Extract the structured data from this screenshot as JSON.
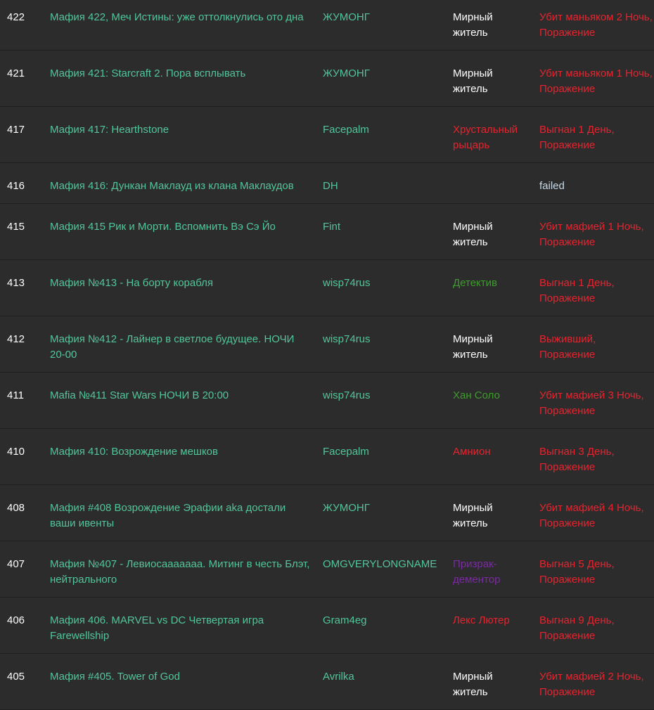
{
  "colors": {
    "background": "#2c2c2c",
    "link": "#52c59b",
    "civilian": "#ffffff",
    "red": "#e8232e",
    "green": "#3f9b2e",
    "purple": "#7b2aa3",
    "failed": "#c8dce8"
  },
  "games": [
    {
      "number": "422",
      "title": "Мафия 422, Меч Истины: уже оттолкнулись ото дна",
      "host": "ЖУМОНГ",
      "role": "Мирный житель",
      "role_color": "white",
      "result": "Убит маньяком 2 Ночь, Поражение",
      "result_color": "red"
    },
    {
      "number": "421",
      "title": "Мафия 421: Starcraft 2. Пора всплывать",
      "host": "ЖУМОНГ",
      "role": "Мирный житель",
      "role_color": "white",
      "result": "Убит маньяком 1 Ночь, Поражение",
      "result_color": "red"
    },
    {
      "number": "417",
      "title": "Мафия 417: Hearthstone",
      "host": "Facepalm",
      "role": "Хрустальный рыцарь",
      "role_color": "red",
      "result": "Выгнан 1 День, Поражение",
      "result_color": "red"
    },
    {
      "number": "416",
      "title": "Мафия 416: Дункан Маклауд из клана Маклаудов",
      "host": "DH",
      "role": "",
      "role_color": "white",
      "result": "failed",
      "result_color": "failed"
    },
    {
      "number": "415",
      "title": "Мафия 415 Рик и Морти. Вспомнить Вэ Сэ Йо",
      "host": "Fint",
      "role": "Мирный житель",
      "role_color": "white",
      "result": "Убит мафией 1 Ночь, Поражение",
      "result_color": "red"
    },
    {
      "number": "413",
      "title": "Мафия №413 - На борту корабля",
      "host": "wisp74rus",
      "role": "Детектив",
      "role_color": "green",
      "result": "Выгнан 1 День, Поражение",
      "result_color": "red"
    },
    {
      "number": "412",
      "title": "Мафия №412 - Лайнер в светлое будущее. НОЧИ 20-00",
      "host": "wisp74rus",
      "role": "Мирный житель",
      "role_color": "white",
      "result": "Выживший, Поражение",
      "result_color": "red"
    },
    {
      "number": "411",
      "title": "Mafia №411 Star Wars НОЧИ В 20:00",
      "host": "wisp74rus",
      "role": "Хан Соло",
      "role_color": "green",
      "result": "Убит мафией 3 Ночь, Поражение",
      "result_color": "red"
    },
    {
      "number": "410",
      "title": "Мафия 410: Возрождение мешков",
      "host": "Facepalm",
      "role": "Амнион",
      "role_color": "red",
      "result": "Выгнан 3 День, Поражение",
      "result_color": "red"
    },
    {
      "number": "408",
      "title": "Мафия #408 Возрождение Эрафии aka достали ваши ивенты",
      "host": "ЖУМОНГ",
      "role": "Мирный житель",
      "role_color": "white",
      "result": "Убит мафией 4 Ночь, Поражение",
      "result_color": "red"
    },
    {
      "number": "407",
      "title": "Мафия №407 - Левиосааааааа. Митинг в честь Блэт, нейтрального",
      "host": "OMGVERYLONGNAME",
      "role": "Призрак-дементор",
      "role_color": "purple",
      "result": "Выгнан 5 День, Поражение",
      "result_color": "red"
    },
    {
      "number": "406",
      "title": "Мафия 406. MARVEL vs DC Четвертая игра Farewellship",
      "host": "Gram4eg",
      "role": "Лекс Лютер",
      "role_color": "red",
      "result": "Выгнан 9 День, Поражение",
      "result_color": "red"
    },
    {
      "number": "405",
      "title": "Мафия #405. Tower of God",
      "host": "Avrilka",
      "role": "Мирный житель",
      "role_color": "white",
      "result": "Убит мафией 2 Ночь, Поражение",
      "result_color": "red"
    }
  ]
}
